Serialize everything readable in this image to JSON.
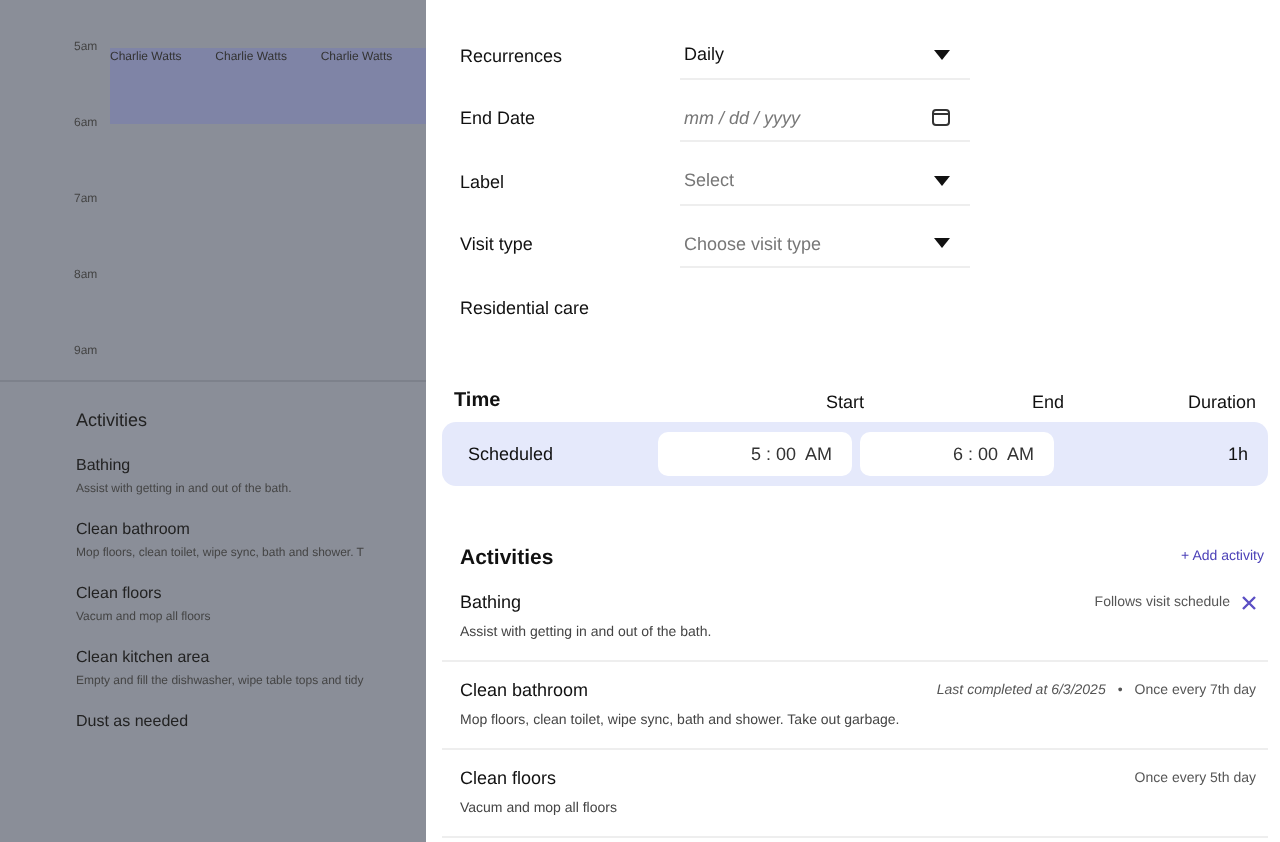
{
  "background": {
    "time_labels": [
      "5am",
      "6am",
      "7am",
      "8am",
      "9am"
    ],
    "events": [
      "Charlie Watts",
      "Charlie Watts",
      "Charlie Watts"
    ],
    "activities_title": "Activities",
    "activities": [
      {
        "name": "Bathing",
        "description": "Assist with getting in and out of the bath."
      },
      {
        "name": "Clean bathroom",
        "description": "Mop floors, clean toilet, wipe sync, bath and shower. T"
      },
      {
        "name": "Clean floors",
        "description": "Vacum and mop all floors"
      },
      {
        "name": "Clean kitchen area",
        "description": "Empty and fill the dishwasher, wipe table tops and tidy"
      },
      {
        "name": "Dust as needed"
      }
    ]
  },
  "drawer": {
    "fields": [
      {
        "label": "Recurrences",
        "kind": "select",
        "value": "Daily"
      },
      {
        "label": "End Date",
        "kind": "date",
        "placeholder": "mm / dd / yyyy"
      },
      {
        "label": "Label",
        "kind": "select",
        "placeholder": "Select"
      },
      {
        "label": "Visit type",
        "kind": "select",
        "placeholder": "Choose visit type"
      },
      {
        "label": "Residential care",
        "kind": "none"
      }
    ],
    "time": {
      "headers": [
        "Time",
        "Start",
        "End",
        "Duration"
      ],
      "row": {
        "label": "Scheduled",
        "start": "5 : 00  AM",
        "end": "6 : 00  AM",
        "duration": "1h"
      }
    },
    "activities_title": "Activities",
    "add_label": "+ Add activity",
    "activities": [
      {
        "name": "Bathing",
        "description": "Assist with getting in and out of the bath.",
        "schedule": "Follows visit schedule",
        "removable": true
      },
      {
        "name": "Clean bathroom",
        "description": "Mop floors, clean toilet, wipe sync, bath and shower. Take out garbage.",
        "last_completed": "Last completed at 6/3/2025",
        "separator": "•",
        "schedule": "Once every 7th day",
        "removable": false
      },
      {
        "name": "Clean floors",
        "description": "Vacum and mop all floors",
        "schedule": "Once every 5th day",
        "removable": false
      }
    ]
  }
}
